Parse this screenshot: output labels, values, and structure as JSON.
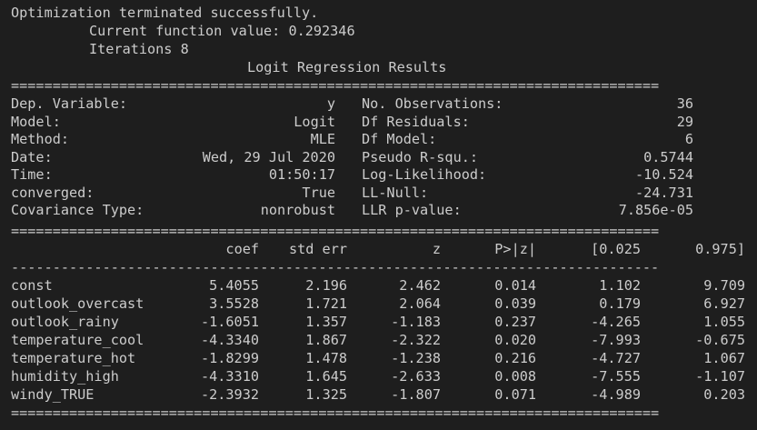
{
  "header": {
    "line1": "Optimization terminated successfully.",
    "line2": "Current function value: 0.292346",
    "line3": "Iterations 8"
  },
  "title": "Logit Regression Results",
  "rules": {
    "double": "==============================================================================",
    "single": "------------------------------------------------------------------------------"
  },
  "summary": {
    "left": [
      {
        "label": "Dep. Variable:",
        "value": "y"
      },
      {
        "label": "Model:",
        "value": "Logit"
      },
      {
        "label": "Method:",
        "value": "MLE"
      },
      {
        "label": "Date:",
        "value": "Wed, 29 Jul 2020"
      },
      {
        "label": "Time:",
        "value": "01:50:17"
      },
      {
        "label": "converged:",
        "value": "True"
      },
      {
        "label": "Covariance Type:",
        "value": "nonrobust"
      }
    ],
    "right": [
      {
        "label": "No. Observations:",
        "value": "36"
      },
      {
        "label": "Df Residuals:",
        "value": "29"
      },
      {
        "label": "Df Model:",
        "value": "6"
      },
      {
        "label": "Pseudo R-squ.:",
        "value": "0.5744"
      },
      {
        "label": "Log-Likelihood:",
        "value": "-10.524"
      },
      {
        "label": "LL-Null:",
        "value": "-24.731"
      },
      {
        "label": "LLR p-value:",
        "value": "7.856e-05"
      }
    ]
  },
  "coef_table": {
    "columns": [
      "coef",
      "std err",
      "z",
      "P>|z|",
      "[0.025",
      "0.975]"
    ],
    "rows": [
      {
        "name": "const",
        "values": [
          "5.4055",
          "2.196",
          "2.462",
          "0.014",
          "1.102",
          "9.709"
        ]
      },
      {
        "name": "outlook_overcast",
        "values": [
          "3.5528",
          "1.721",
          "2.064",
          "0.039",
          "0.179",
          "6.927"
        ]
      },
      {
        "name": "outlook_rainy",
        "values": [
          "-1.6051",
          "1.357",
          "-1.183",
          "0.237",
          "-4.265",
          "1.055"
        ]
      },
      {
        "name": "temperature_cool",
        "values": [
          "-4.3340",
          "1.867",
          "-2.322",
          "0.020",
          "-7.993",
          "-0.675"
        ]
      },
      {
        "name": "temperature_hot",
        "values": [
          "-1.8299",
          "1.478",
          "-1.238",
          "0.216",
          "-4.727",
          "1.067"
        ]
      },
      {
        "name": "humidity_high",
        "values": [
          "-4.3310",
          "1.645",
          "-2.633",
          "0.008",
          "-7.555",
          "-1.107"
        ]
      },
      {
        "name": "windy_TRUE",
        "values": [
          "-2.3932",
          "1.325",
          "-1.807",
          "0.071",
          "-4.989",
          "0.203"
        ]
      }
    ]
  }
}
